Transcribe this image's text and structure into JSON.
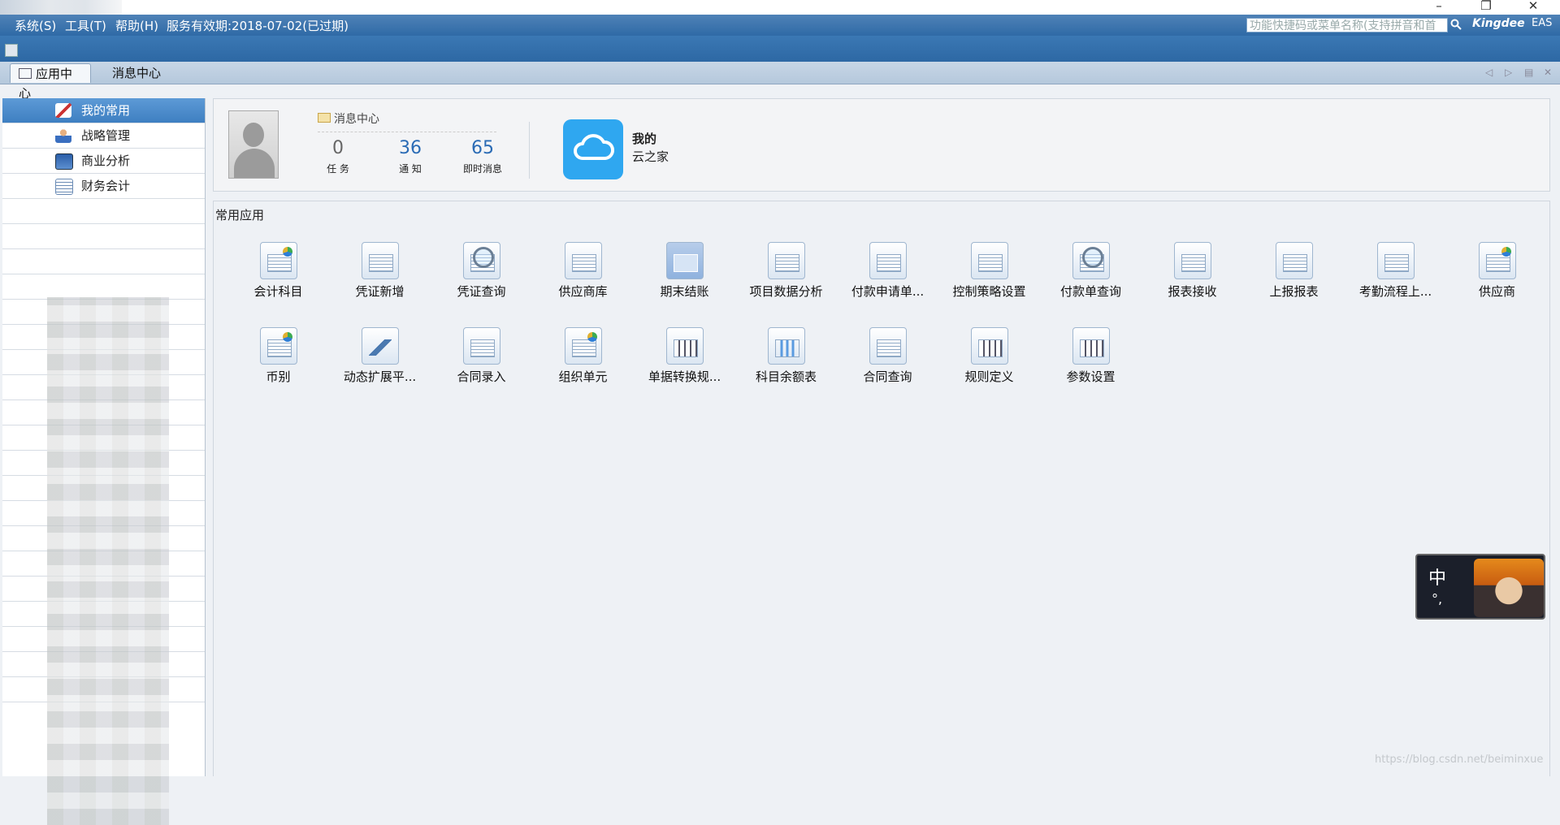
{
  "window": {
    "minimize": "–",
    "restore": "❐",
    "close": "✕"
  },
  "menu": {
    "items": [
      "系统(S)",
      "工具(T)",
      "帮助(H)"
    ],
    "service_info": "服务有效期:2018-07-02(已过期)",
    "search_placeholder": "功能快捷码或菜单名称(支持拼音和首",
    "brand": "Kingdee",
    "brand_suffix": "EAS"
  },
  "tabs": [
    {
      "label": "应用中心",
      "active": true
    },
    {
      "label": "消息中心",
      "active": false
    }
  ],
  "sidebar": {
    "items": [
      {
        "label": "我的常用",
        "icon": "pen-icon",
        "active": true
      },
      {
        "label": "战略管理",
        "icon": "person-icon"
      },
      {
        "label": "商业分析",
        "icon": "analysis-icon"
      },
      {
        "label": "财务会计",
        "icon": "ledger-icon"
      }
    ]
  },
  "user_panel": {
    "message_center": "消息中心",
    "stats": [
      {
        "value": "0",
        "label": "任 务"
      },
      {
        "value": "36",
        "label": "通 知"
      },
      {
        "value": "65",
        "label": "即时消息"
      }
    ],
    "cloud_line1": "我的",
    "cloud_line2": "云之家"
  },
  "apps": {
    "header": "常用应用",
    "items": [
      {
        "label": "会计科目",
        "icon": "chart-icon"
      },
      {
        "label": "凭证新增",
        "icon": "form-icon"
      },
      {
        "label": "凭证查询",
        "icon": "magnifier-icon"
      },
      {
        "label": "供应商库",
        "icon": "form-icon"
      },
      {
        "label": "期末结账",
        "icon": "blue-square-icon"
      },
      {
        "label": "项目数据分析",
        "icon": "form-icon"
      },
      {
        "label": "付款申请单...",
        "icon": "form-icon"
      },
      {
        "label": "控制策略设置",
        "icon": "form-icon"
      },
      {
        "label": "付款单查询",
        "icon": "magnifier-icon"
      },
      {
        "label": "报表接收",
        "icon": "form-icon"
      },
      {
        "label": "上报报表",
        "icon": "form-icon"
      },
      {
        "label": "考勤流程上...",
        "icon": "form-icon"
      },
      {
        "label": "供应商",
        "icon": "chart-icon"
      },
      {
        "label": "币别",
        "icon": "chart-icon"
      },
      {
        "label": "动态扩展平...",
        "icon": "wrench-icon"
      },
      {
        "label": "合同录入",
        "icon": "form-icon"
      },
      {
        "label": "组织单元",
        "icon": "chart-icon"
      },
      {
        "label": "单据转换规...",
        "icon": "slider-icon"
      },
      {
        "label": "科目余额表",
        "icon": "bar-chart-icon"
      },
      {
        "label": "合同查询",
        "icon": "form-icon"
      },
      {
        "label": "规则定义",
        "icon": "slider-icon"
      },
      {
        "label": "参数设置",
        "icon": "slider-icon"
      }
    ]
  },
  "ime": {
    "char": "中",
    "punct": "°,"
  },
  "watermark": "https://blog.csdn.net/beiminxue"
}
